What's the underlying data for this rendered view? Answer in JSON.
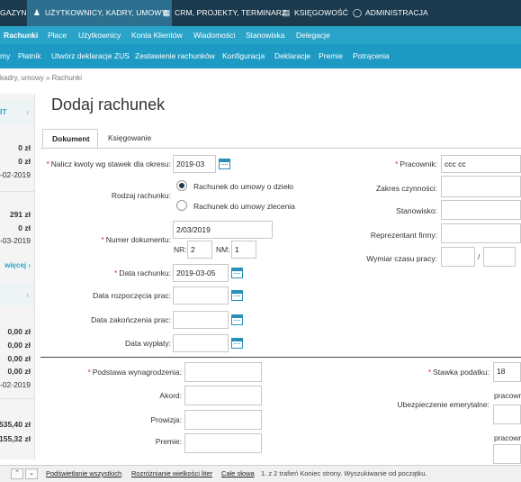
{
  "top_nav": {
    "items": [
      {
        "label": "GAZYN",
        "icon": ""
      },
      {
        "label": "UŻYTKOWNICY, KADRY, UMOWY",
        "icon": "users-icon"
      },
      {
        "label": "CRM, PROJEKTY, TERMINARZ",
        "icon": "calendar-icon"
      },
      {
        "label": "KSIĘGOWOŚĆ",
        "icon": "book-icon"
      },
      {
        "label": "ADMINISTRACJA",
        "icon": "shield-icon"
      }
    ],
    "active": "UŻYTKOWNICY, KADRY, UMOWY"
  },
  "sub_nav": {
    "items": [
      "Rachunki",
      "Płace",
      "Użytkownicy",
      "Konta Klientów",
      "Wiadomości",
      "Stanowiska",
      "Delegacje"
    ],
    "active": "Rachunki"
  },
  "sub_nav2": {
    "items": [
      "my",
      "Płatnik",
      "Utwórz deklaracje ZUS",
      "Zestawienie rachunków",
      "Konfiguracja",
      "Deklaracje",
      "Premie",
      "Potrącenia"
    ]
  },
  "breadcrumb": "kadry, umowy » Rachunki",
  "left_panel": {
    "header1": "IT",
    "v1": "0 zł",
    "v2": "0 zł",
    "d1": "-02-2019",
    "v3": "291 zł",
    "v4": "0 zł",
    "d2": "-03-2019",
    "more": "więcej",
    "v5": "0,00 zł",
    "v6": "0,00 zł",
    "v7": "0,00 zł",
    "v8": "0,00 zł",
    "d3": "-02-2019",
    "v9": "535,40 zł",
    "v10": "155,32 zł"
  },
  "page_title": "Dodaj rachunek",
  "tabs": [
    "Dokument",
    "Księgowanie"
  ],
  "form": {
    "nalicz_label": "Nalicz kwoty wg stawek dla okresu:",
    "nalicz_value": "2019-03",
    "rodzaj_label": "Rodzaj rachunku:",
    "radio1": "Rachunek do umowy o dzieło",
    "radio2": "Rachunek do umowy zlecenia",
    "numer_label": "Numer dokumentu:",
    "numer_value": "2/03/2019",
    "nr_label": "NR:",
    "nr_value": "2",
    "nm_label": "NM:",
    "nm_value": "1",
    "data_label": "Data rachunku:",
    "data_value": "2019-03-05",
    "rozpoczecia_label": "Data rozpoczęcia prac:",
    "zakonczenia_label": "Data zakończenia prac:",
    "wyplaty_label": "Data wypłaty:",
    "pracownik_label": "Pracownik:",
    "pracownik_value": "ccc cc",
    "zakres_label": "Zakres czynności:",
    "stanowisko_label": "Stanowisko:",
    "reprezentant_label": "Reprezentant firmy:",
    "wymiar_label": "Wymiar czasu pracy:",
    "wymiar_sep": "/",
    "podstawa_label": "Podstawa wynagrodzenia:",
    "akord_label": "Akord:",
    "prowizja_label": "Prowizja:",
    "premie_label": "Premie:",
    "stawka_label": "Stawka podatku:",
    "stawka_value": "18",
    "emerytalne_label": "Ubezpieczenie emerytalne:",
    "pracown1": "pracown",
    "pracown2": "pracown"
  },
  "find_bar": {
    "highlight_all": "Podświetlanie wszystkich",
    "match_case": "Rozróżnianie wielkości liter",
    "whole_words": "Całe słowa",
    "status": "1. z 2 trafień   Koniec strony. Wyszukiwanie od początku."
  },
  "colors": {
    "top_bar": "#1b3a4e",
    "nav_accent": "#2aa3c8",
    "required": "#e03030"
  }
}
